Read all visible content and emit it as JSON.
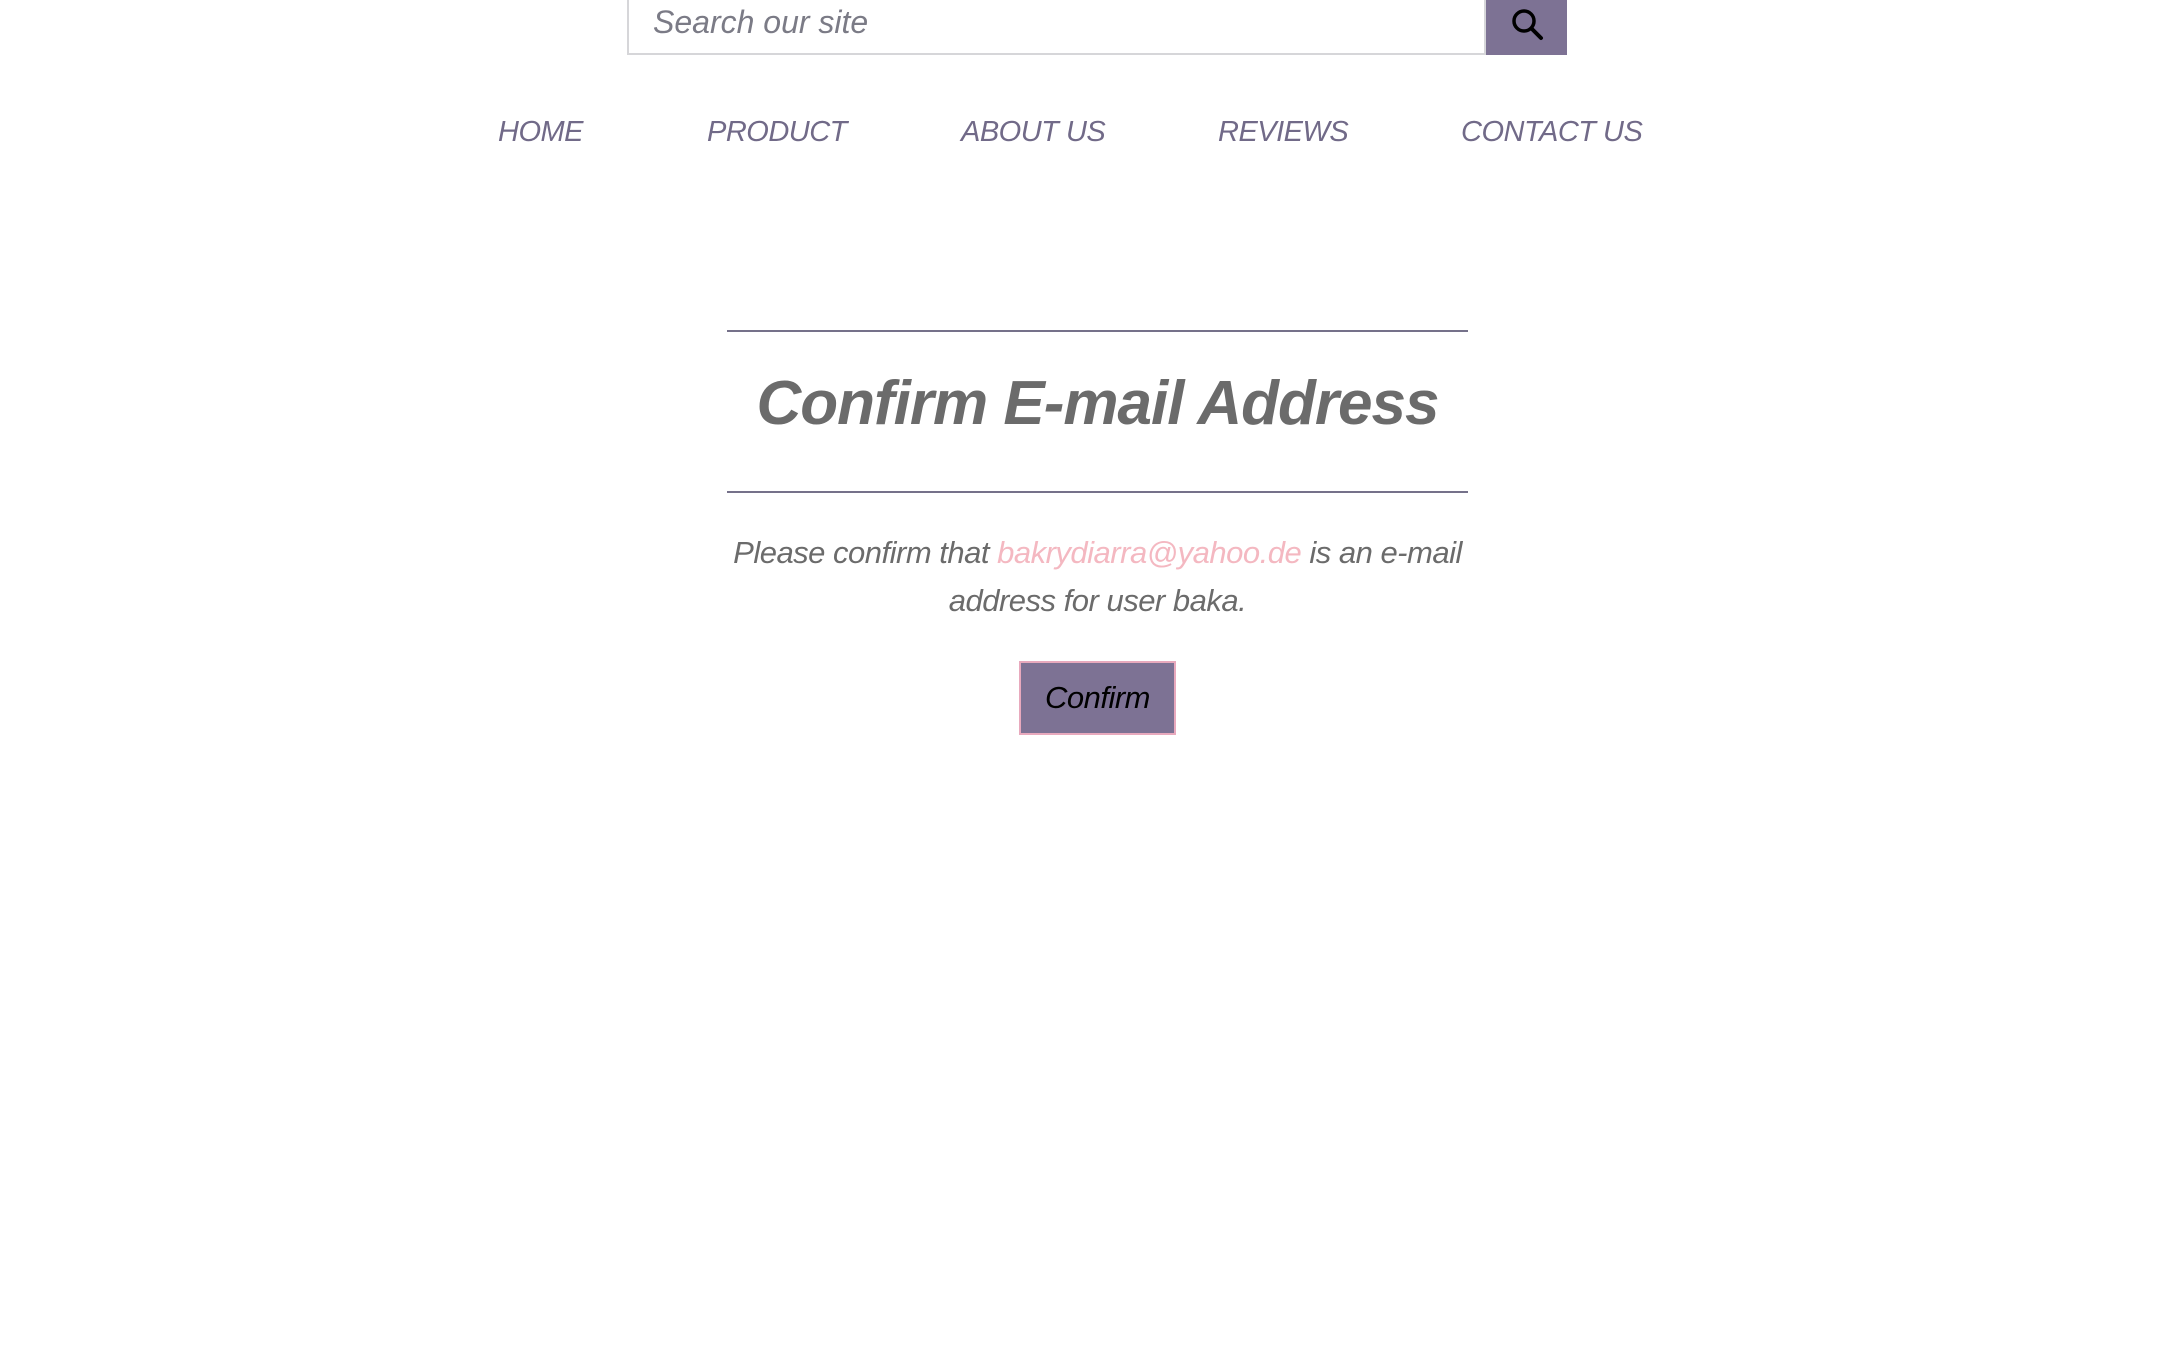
{
  "search": {
    "placeholder": "Search our site",
    "button_icon": "search-icon"
  },
  "nav": {
    "items": [
      {
        "label": "HOME"
      },
      {
        "label": "PRODUCT"
      },
      {
        "label": "ABOUT US"
      },
      {
        "label": "REVIEWS"
      },
      {
        "label": "CONTACT US"
      }
    ]
  },
  "main": {
    "title": "Confirm E-mail Address",
    "message_prefix": "Please confirm that",
    "email": "bakrydiarra@yahoo.de",
    "message_suffix": "is an e-mail address for user baka.",
    "confirm_label": "Confirm"
  },
  "colors": {
    "accent": "#7d7294",
    "nav_text": "#716a88",
    "body_text": "#6b6b6b",
    "link": "#f4b8c1",
    "button_border": "#e8a9bd"
  }
}
